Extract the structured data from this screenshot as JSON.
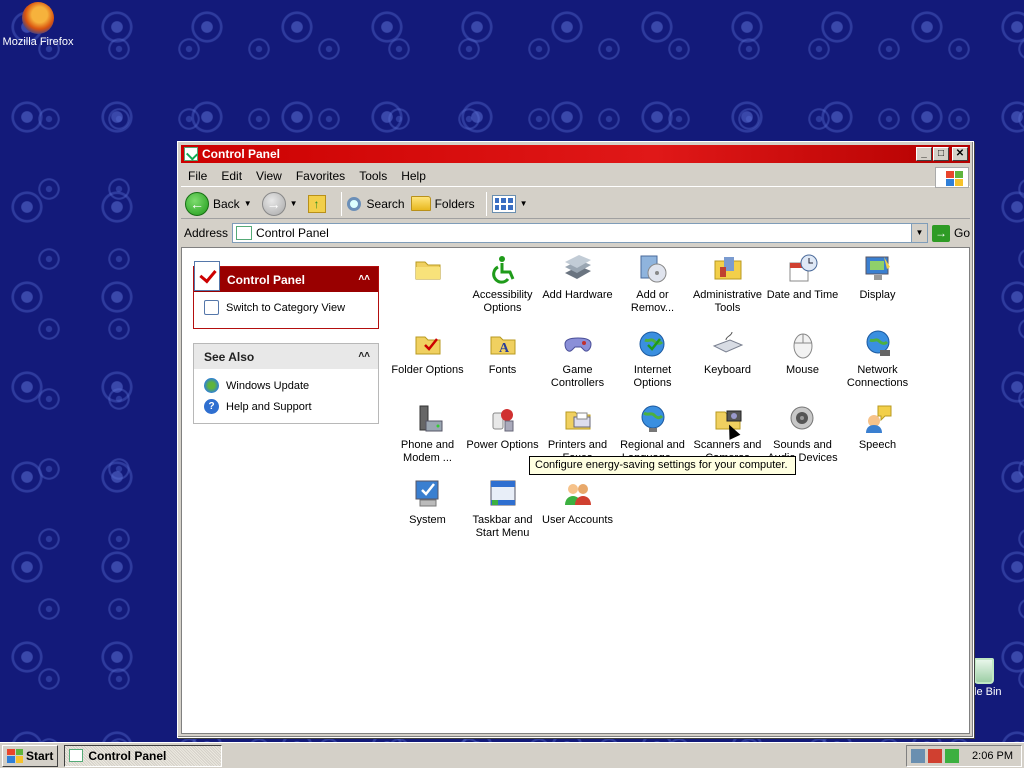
{
  "desktop": {
    "firefox_label": "Mozilla Firefox",
    "recycle_bin_label": "le Bin"
  },
  "window": {
    "title": "Control Panel",
    "controls": {
      "minimize": "_",
      "maximize": "□",
      "close": "✕"
    }
  },
  "menu": [
    "File",
    "Edit",
    "View",
    "Favorites",
    "Tools",
    "Help"
  ],
  "toolbar": {
    "back_label": "Back",
    "search_label": "Search",
    "folders_label": "Folders"
  },
  "address": {
    "label": "Address",
    "value": "Control Panel",
    "go_label": "Go"
  },
  "left_pane": {
    "control_panel": {
      "heading": "Control Panel",
      "link": "Switch to Category View"
    },
    "see_also": {
      "heading": "See Also",
      "links": [
        "Windows Update",
        "Help and Support"
      ]
    }
  },
  "items": [
    {
      "label": "",
      "icon": "folder-icon"
    },
    {
      "label": "Accessibility Options",
      "icon": "accessibility-icon"
    },
    {
      "label": "Add Hardware",
      "icon": "add-hardware-icon"
    },
    {
      "label": "Add or Remov...",
      "icon": "add-remove-programs-icon"
    },
    {
      "label": "Administrative Tools",
      "icon": "admin-tools-icon"
    },
    {
      "label": "Date and Time",
      "icon": "date-time-icon"
    },
    {
      "label": "Display",
      "icon": "display-icon"
    },
    {
      "label": "Folder Options",
      "icon": "folder-options-icon"
    },
    {
      "label": "Fonts",
      "icon": "fonts-icon"
    },
    {
      "label": "Game Controllers",
      "icon": "game-controllers-icon"
    },
    {
      "label": "Internet Options",
      "icon": "internet-options-icon"
    },
    {
      "label": "Keyboard",
      "icon": "keyboard-icon"
    },
    {
      "label": "Mouse",
      "icon": "mouse-icon"
    },
    {
      "label": "Network Connections",
      "icon": "network-connections-icon"
    },
    {
      "label": "Phone and Modem ...",
      "icon": "phone-modem-icon"
    },
    {
      "label": "Power Options",
      "icon": "power-options-icon"
    },
    {
      "label": "Printers and Faxes",
      "icon": "printers-faxes-icon"
    },
    {
      "label": "Regional and Language ...",
      "icon": "regional-language-icon"
    },
    {
      "label": "Scanners and Cameras",
      "icon": "scanners-cameras-icon"
    },
    {
      "label": "Sounds and Audio Devices",
      "icon": "sounds-audio-icon"
    },
    {
      "label": "Speech",
      "icon": "speech-icon"
    },
    {
      "label": "System",
      "icon": "system-icon"
    },
    {
      "label": "Taskbar and Start Menu",
      "icon": "taskbar-start-menu-icon"
    },
    {
      "label": "User Accounts",
      "icon": "user-accounts-icon"
    }
  ],
  "tooltip": "Configure energy-saving settings for your computer.",
  "taskbar": {
    "start_label": "Start",
    "task_label": "Control Panel",
    "clock": "2:06 PM"
  },
  "colors": {
    "titlebar": "#cc0000",
    "desktop": "#131a7a",
    "panel_header": "#990000"
  }
}
